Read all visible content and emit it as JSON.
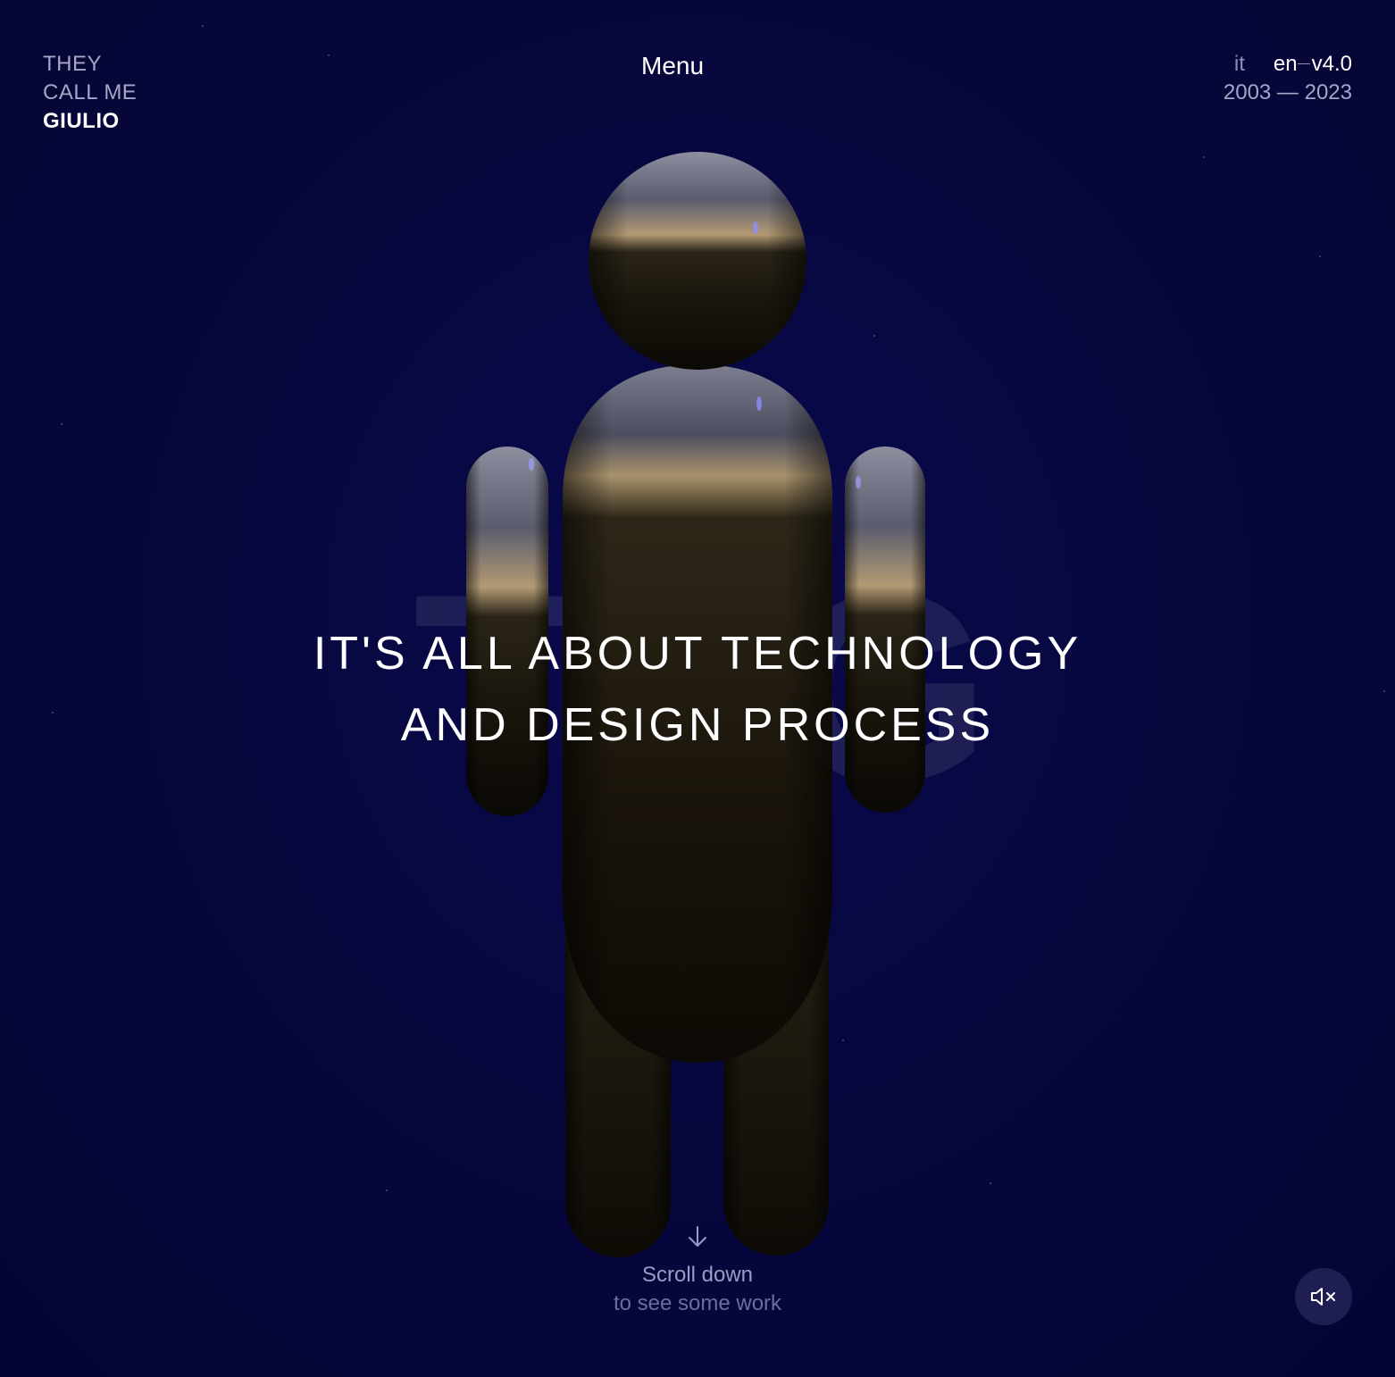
{
  "logo": {
    "line1": "THEY",
    "line2": "CALL ME",
    "line3": "GIULIO"
  },
  "nav": {
    "menu_label": "Menu"
  },
  "lang": {
    "it": "it",
    "en": "en",
    "version": "v4.0",
    "years": "2003 — 2023"
  },
  "hero": {
    "bg_letters": "TMG",
    "headline_line1": "IT'S ALL ABOUT TECHNOLOGY",
    "headline_line2": "AND DESIGN PROCESS"
  },
  "scroll": {
    "line1": "Scroll down",
    "line2": "to see some work",
    "icon": "arrow-down-icon"
  },
  "sound": {
    "icon": "speaker-muted-icon"
  },
  "colors": {
    "background": "#06063a",
    "text": "#ffffff",
    "muted": "#a6a6c8"
  }
}
